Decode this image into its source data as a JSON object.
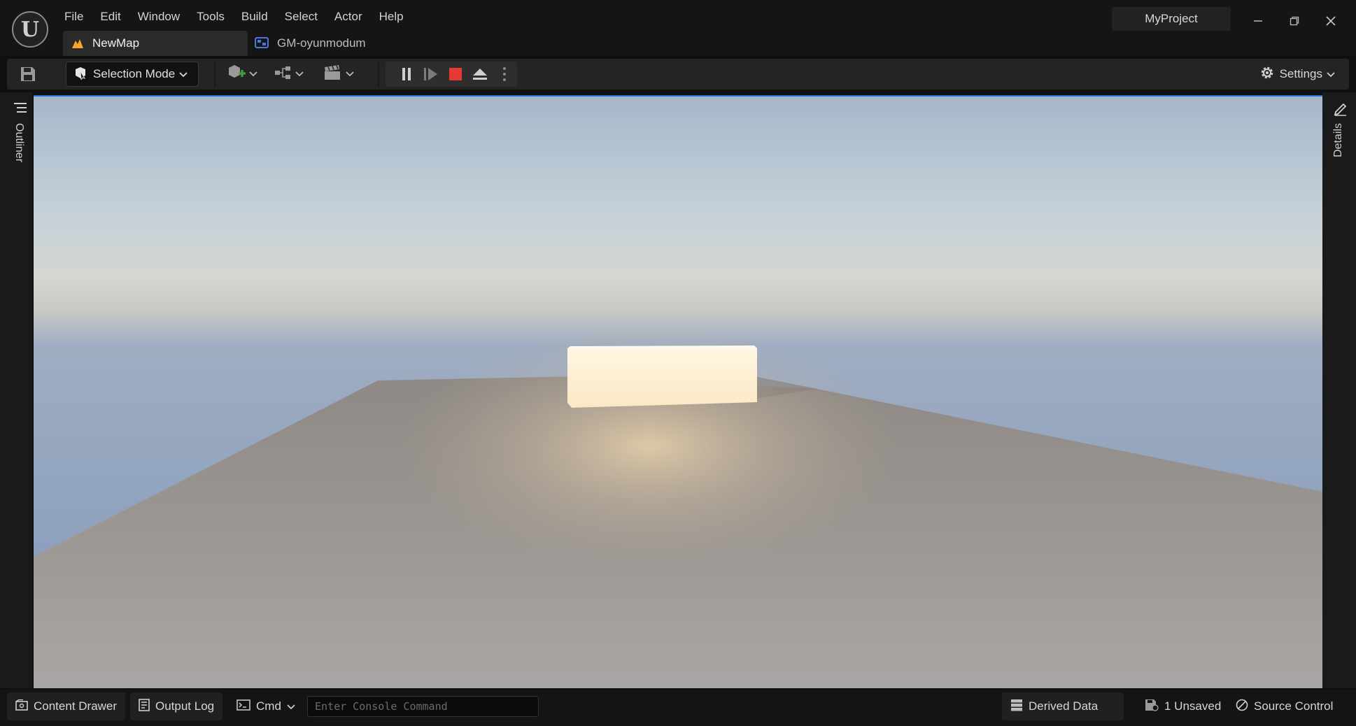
{
  "app": {
    "logo_icon": "unreal-engine-logo-icon",
    "logo_glyph": "U",
    "project_name": "MyProject"
  },
  "menu": [
    "File",
    "Edit",
    "Window",
    "Tools",
    "Build",
    "Select",
    "Actor",
    "Help"
  ],
  "tabs": [
    {
      "label": "NewMap",
      "icon": "level-map-icon",
      "active": true
    },
    {
      "label": "GM-oyunmodum",
      "icon": "blueprint-icon",
      "active": false
    }
  ],
  "window_controls": [
    "minimize-icon",
    "restore-icon",
    "close-icon"
  ],
  "toolbar": {
    "save_icon": "save-icon",
    "selection_mode_label": "Selection Mode",
    "dropdowns": [
      "add-actor-icon",
      "blueprint-graph-icon",
      "cinematics-icon"
    ],
    "play_controls": [
      "pause-icon",
      "step-frame-icon",
      "stop-icon",
      "eject-icon",
      "more-options-icon"
    ],
    "settings_label": "Settings"
  },
  "side_panels": {
    "left": {
      "label": "Outliner",
      "icon": "outliner-icon"
    },
    "right": {
      "label": "Details",
      "icon": "details-icon"
    }
  },
  "statusbar": {
    "content_drawer": "Content Drawer",
    "output_log": "Output Log",
    "cmd_label": "Cmd",
    "console_placeholder": "Enter Console Command",
    "derived_data": "Derived Data",
    "unsaved": "1 Unsaved",
    "source_control": "Source Control"
  },
  "colors": {
    "accent": "#1d6fd6",
    "stop_red": "#e53935",
    "add_green": "#43a047",
    "map_orange": "#f4a62a"
  }
}
